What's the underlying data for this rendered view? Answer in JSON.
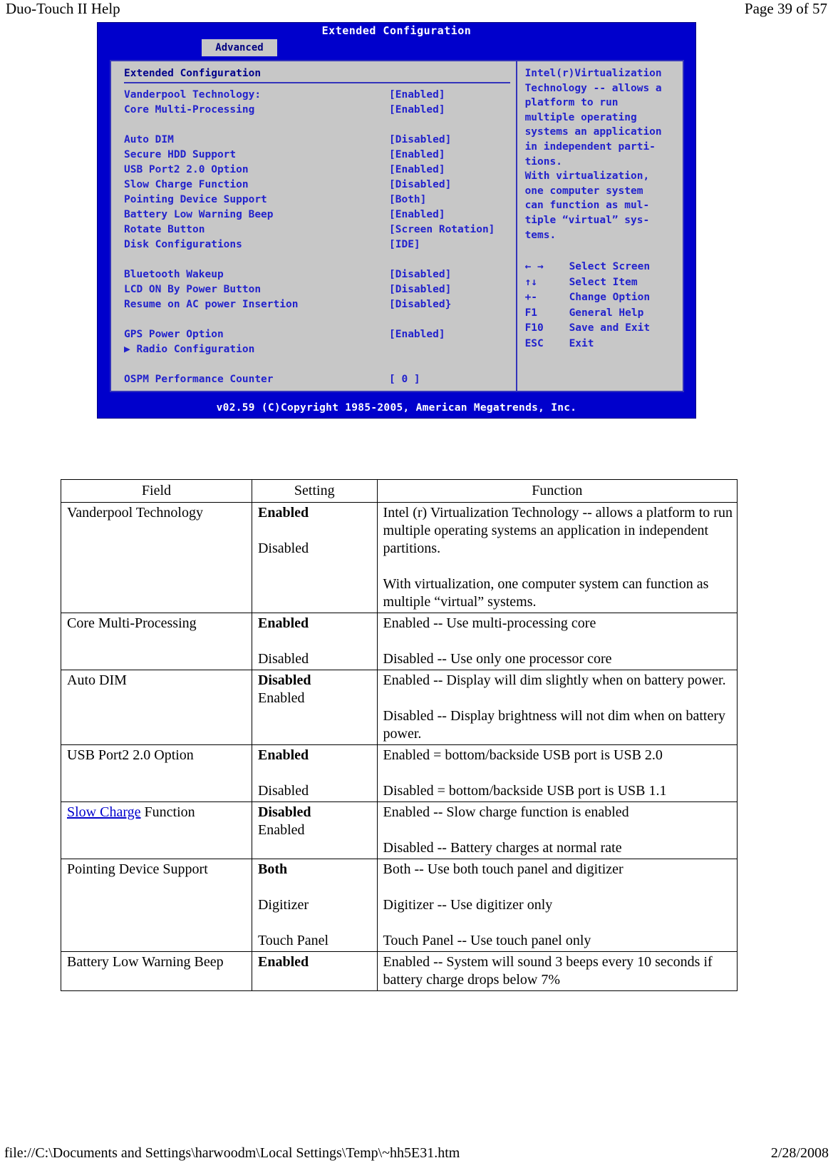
{
  "header": {
    "doc_title": "Duo-Touch II Help",
    "page_indicator": "Page 39 of 57"
  },
  "bios": {
    "title": "Extended Configuration",
    "tab": "Advanced",
    "section_title": "Extended Configuration",
    "items": [
      {
        "label": "Vanderpool Technology:",
        "value": "[Enabled]"
      },
      {
        "label": "Core Multi-Processing",
        "value": "[Enabled]"
      },
      {
        "label": "",
        "value": ""
      },
      {
        "label": "Auto DIM",
        "value": "[Disabled]"
      },
      {
        "label": "Secure HDD Support",
        "value": "[Enabled]"
      },
      {
        "label": "USB Port2 2.0 Option",
        "value": "[Enabled]"
      },
      {
        "label": "Slow Charge Function",
        "value": "[Disabled]"
      },
      {
        "label": "Pointing Device Support",
        "value": "[Both]"
      },
      {
        "label": "Battery Low Warning Beep",
        "value": "[Enabled]"
      },
      {
        "label": "Rotate Button",
        "value": "[Screen Rotation]"
      },
      {
        "label": "Disk Configurations",
        "value": "[IDE]"
      },
      {
        "label": "",
        "value": ""
      },
      {
        "label": "Bluetooth Wakeup",
        "value": "[Disabled]"
      },
      {
        "label": "LCD ON By Power Button",
        "value": "[Disabled]"
      },
      {
        "label": "Resume on AC power Insertion",
        "value": "[Disabled}"
      },
      {
        "label": "",
        "value": ""
      },
      {
        "label": "GPS Power Option",
        "value": "[Enabled]"
      },
      {
        "label": "▶  Radio Configuration",
        "value": ""
      },
      {
        "label": "",
        "value": ""
      },
      {
        "label": "OSPM Performance Counter",
        "value": "[ 0 ]"
      }
    ],
    "help_lines": [
      "Intel(r)Virtualization",
      "Technology -- allows a",
      "platform to run",
      "multiple operating",
      "systems an application",
      "in independent parti-",
      "tions.",
      "With virtualization,",
      "one computer system",
      "can function as mul-",
      "tiple “virtual” sys-",
      "tems."
    ],
    "keys": [
      {
        "key": "← →",
        "desc": "Select Screen"
      },
      {
        "key": "↑↓",
        "desc": "Select Item"
      },
      {
        "key": "+-",
        "desc": "Change Option"
      },
      {
        "key": "F1",
        "desc": "General Help"
      },
      {
        "key": "F10",
        "desc": "Save and Exit"
      },
      {
        "key": "ESC",
        "desc": "Exit"
      }
    ],
    "copyright": "v02.59 (C)Copyright 1985-2005, American Megatrends, Inc."
  },
  "table": {
    "headers": {
      "field": "Field",
      "setting": "Setting",
      "function": "Function"
    },
    "rows": [
      {
        "field_prefix": "",
        "field_link": "",
        "field": "Vanderpool Technology",
        "setting_bold": "Enabled",
        "setting_rest": "Disabled",
        "setting_gap": "large",
        "function_1": "Intel (r) Virtualization Technology -- allows a platform to run multiple operating systems an application in independent partitions.",
        "function_2": "With virtualization, one computer system can function as multiple “virtual” systems."
      },
      {
        "field": "Core Multi-Processing",
        "setting_bold": "Enabled",
        "setting_rest": "Disabled",
        "setting_gap": "large",
        "function_1": "Enabled -- Use multi-processing core",
        "function_2": "Disabled -- Use only one processor core"
      },
      {
        "field": "Auto DIM",
        "setting_bold": "Disabled",
        "setting_rest": "Enabled",
        "setting_gap": "none",
        "function_1": "Enabled  --  Display will dim slightly when on battery power.",
        "function_2": "Disabled  --  Display brightness will not dim when on battery power."
      },
      {
        "field": "USB Port2 2.0 Option",
        "setting_bold": "Enabled",
        "setting_rest": "Disabled",
        "setting_gap": "large",
        "function_1": "Enabled  =  bottom/backside USB port is USB 2.0",
        "function_2": "Disabled  = bottom/backside USB port is USB 1.1"
      },
      {
        "field_link": "Slow Charge",
        "field": " Function",
        "setting_bold": "Disabled",
        "setting_rest": "Enabled",
        "setting_gap": "none",
        "function_1": "Enabled  --  Slow charge function is enabled",
        "function_2": "Disabled  --  Battery charges at normal rate"
      },
      {
        "field": "Pointing Device Support",
        "setting_bold": "Both",
        "setting_rest": "Digitizer",
        "setting_extra": "Touch Panel",
        "setting_gap": "large",
        "function_1": "Both  --  Use both touch panel and digitizer",
        "function_2": "Digitizer  --  Use digitizer only",
        "function_3": "Touch Panel  --  Use touch panel only"
      },
      {
        "field": "Battery Low Warning Beep",
        "setting_bold": "Enabled",
        "setting_rest": "",
        "setting_gap": "none",
        "function_1": "Enabled -- System will sound 3 beeps every 10 seconds if battery charge drops below 7%",
        "function_2": ""
      }
    ]
  },
  "footer": {
    "path": "file://C:\\Documents and Settings\\harwoodm\\Local Settings\\Temp\\~hh5E31.htm",
    "date": "2/28/2008"
  },
  "colors": {
    "bios_blue": "#0000cc",
    "bios_panel": "#c7c7c7",
    "bios_text": "#2222cc",
    "link": "#0000cc"
  }
}
